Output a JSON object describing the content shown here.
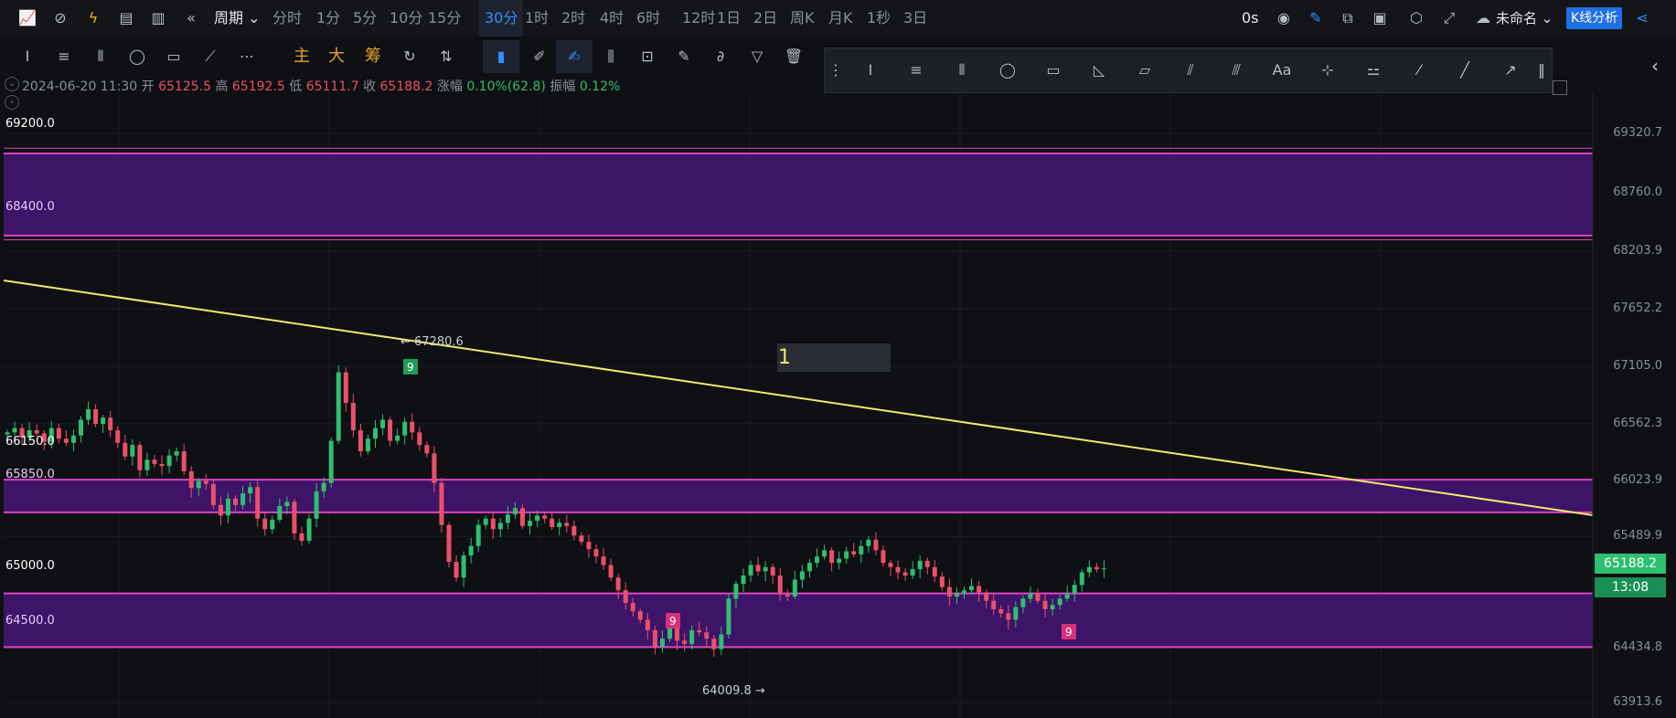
{
  "topbar": {
    "period_label": "周期",
    "timeframes": [
      "分时",
      "1分",
      "5分",
      "10分",
      "15分",
      "30分",
      "1时",
      "2时",
      "4时",
      "6时",
      "12时",
      "1日",
      "2日",
      "周K",
      "月K",
      "1秒",
      "3日"
    ],
    "active_timeframe": "30分",
    "countdown": "0s",
    "workspace_name": "未命名",
    "analysis_button": "K线分析"
  },
  "toolbar": {
    "zhu": "主",
    "da": "大",
    "chou": "筹",
    "more": "⋯"
  },
  "floating_toolbar": {
    "text_tool": "Aa"
  },
  "info": {
    "datetime": "2024-06-20 11:30",
    "open_label": "开",
    "open": "65125.5",
    "high_label": "高",
    "high": "65192.5",
    "low_label": "低",
    "low": "65111.7",
    "close_label": "收",
    "close": "65188.2",
    "change_label": "涨幅",
    "change": "0.10%(62.8)",
    "amp_label": "振幅",
    "amp": "0.12%"
  },
  "chart_data": {
    "type": "candlestick",
    "ylim": [
      63700,
      69700
    ],
    "y_ticks": [
      "69320.7",
      "68760.0",
      "68203.9",
      "67652.2",
      "67105.0",
      "66562.3",
      "66023.9",
      "65489.9",
      "64434.8",
      "63913.6"
    ],
    "current_price": "65188.2",
    "countdown": "13:08",
    "levels": [
      "69200.0",
      "68400.0",
      "66150.0",
      "65850.0",
      "65000.0",
      "64500.0"
    ],
    "zones": [
      {
        "from": 68350,
        "to": 69130
      },
      {
        "from": 65720,
        "to": 66030
      },
      {
        "from": 64440,
        "to": 64950
      }
    ],
    "annotations": {
      "high_marker": "67280.6",
      "low_marker": "64009.8",
      "text_box": "1",
      "nine_label": "9"
    },
    "colors": {
      "up": "#2fbf71",
      "down": "#ec4f6b",
      "zone": "#3d1467",
      "zone_line": "#e040c8",
      "trend": "#f0ea6e",
      "accent": "#1f6fe5"
    }
  }
}
